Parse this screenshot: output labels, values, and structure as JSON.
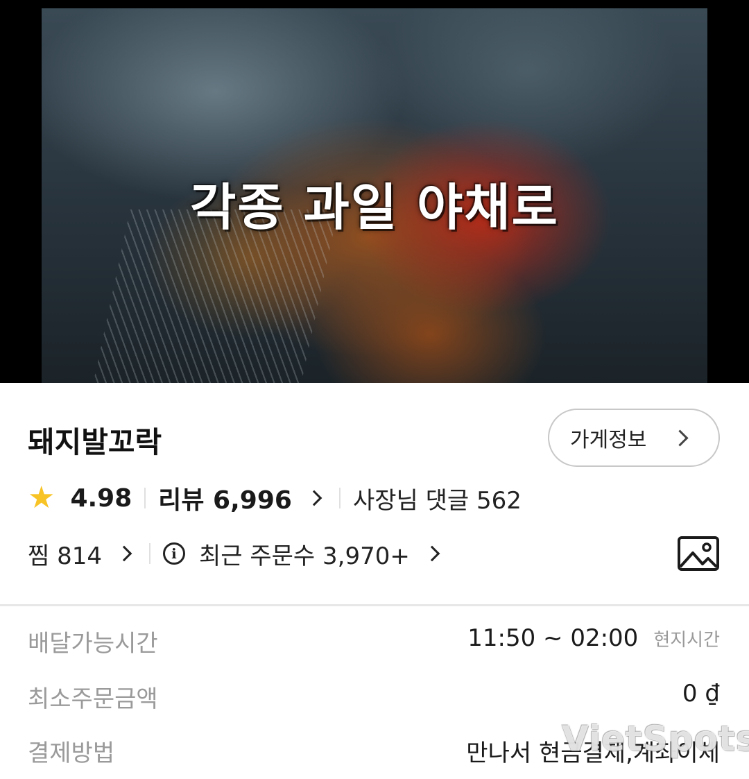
{
  "hero": {
    "caption": "각종 과일 야채로"
  },
  "store": {
    "name": "돼지발꼬락",
    "info_button_label": "가게정보",
    "rating": "4.98",
    "reviews_label": "리뷰 6,996",
    "owner_replies_label": "사장님 댓글 562",
    "favorites_label": "찜 814",
    "recent_orders_label": "최근 주문수 3,970+"
  },
  "details": [
    {
      "key": "배달가능시간",
      "value": "11:50 ~ 02:00",
      "sub": "현지시간"
    },
    {
      "key": "최소주문금액",
      "value": "0 ₫"
    },
    {
      "key": "결제방법",
      "value": "만나서 현금결제,계좌이체"
    }
  ],
  "watermark": "VietSpots",
  "colors": {
    "star": "#f7c325",
    "divider": "#e7e7e7",
    "muted_text": "#9a9a9a"
  },
  "icons": [
    "star-icon",
    "chevron-right-icon",
    "info-icon",
    "image-gallery-icon"
  ]
}
